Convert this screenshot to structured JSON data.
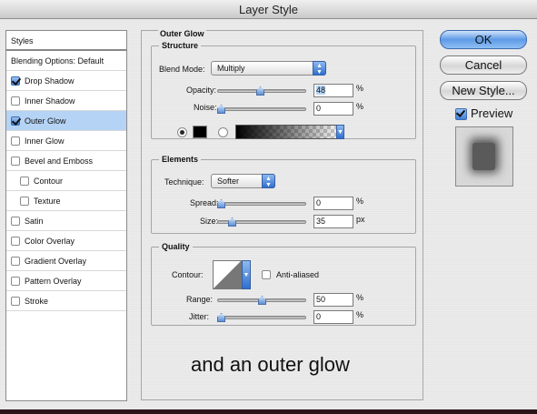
{
  "window": {
    "title": "Layer Style"
  },
  "list": {
    "items": [
      {
        "label": "Styles",
        "checkbox": false,
        "checked": false,
        "selected": false
      },
      {
        "label": "Blending Options: Default",
        "checkbox": false,
        "checked": false,
        "selected": false
      },
      {
        "label": "Drop Shadow",
        "checkbox": true,
        "checked": true,
        "selected": false
      },
      {
        "label": "Inner Shadow",
        "checkbox": true,
        "checked": false,
        "selected": false
      },
      {
        "label": "Outer Glow",
        "checkbox": true,
        "checked": true,
        "selected": true
      },
      {
        "label": "Inner Glow",
        "checkbox": true,
        "checked": false,
        "selected": false
      },
      {
        "label": "Bevel and Emboss",
        "checkbox": true,
        "checked": false,
        "selected": false
      },
      {
        "label": "Contour",
        "checkbox": true,
        "checked": false,
        "selected": false,
        "indent": true
      },
      {
        "label": "Texture",
        "checkbox": true,
        "checked": false,
        "selected": false,
        "indent": true
      },
      {
        "label": "Satin",
        "checkbox": true,
        "checked": false,
        "selected": false
      },
      {
        "label": "Color Overlay",
        "checkbox": true,
        "checked": false,
        "selected": false
      },
      {
        "label": "Gradient Overlay",
        "checkbox": true,
        "checked": false,
        "selected": false
      },
      {
        "label": "Pattern Overlay",
        "checkbox": true,
        "checked": false,
        "selected": false
      },
      {
        "label": "Stroke",
        "checkbox": true,
        "checked": false,
        "selected": false
      }
    ]
  },
  "panel": {
    "title": "Outer Glow",
    "structure": {
      "title": "Structure",
      "blend_mode_label": "Blend Mode:",
      "blend_mode_value": "Multiply",
      "opacity_label": "Opacity:",
      "opacity_value": "48",
      "opacity_fraction": 0.48,
      "noise_label": "Noise:",
      "noise_value": "0",
      "noise_fraction": 0,
      "percent": "%"
    },
    "elements": {
      "title": "Elements",
      "technique_label": "Technique:",
      "technique_value": "Softer",
      "spread_label": "Spread:",
      "spread_value": "0",
      "spread_fraction": 0,
      "size_label": "Size:",
      "size_value": "35",
      "size_fraction": 0.14,
      "percent": "%",
      "px": "px"
    },
    "quality": {
      "title": "Quality",
      "contour_label": "Contour:",
      "anti_aliased_label": "Anti-aliased",
      "range_label": "Range:",
      "range_value": "50",
      "range_fraction": 0.5,
      "jitter_label": "Jitter:",
      "jitter_value": "0",
      "jitter_fraction": 0,
      "percent": "%"
    },
    "caption": "and an outer glow"
  },
  "buttons": {
    "ok": "OK",
    "cancel": "Cancel",
    "new_style": "New Style...",
    "preview_label": "Preview",
    "preview_checked": true
  },
  "colors": {
    "accent": "#3f7fd8",
    "selection": "#b5d3f5",
    "glow_color": "#000000"
  }
}
